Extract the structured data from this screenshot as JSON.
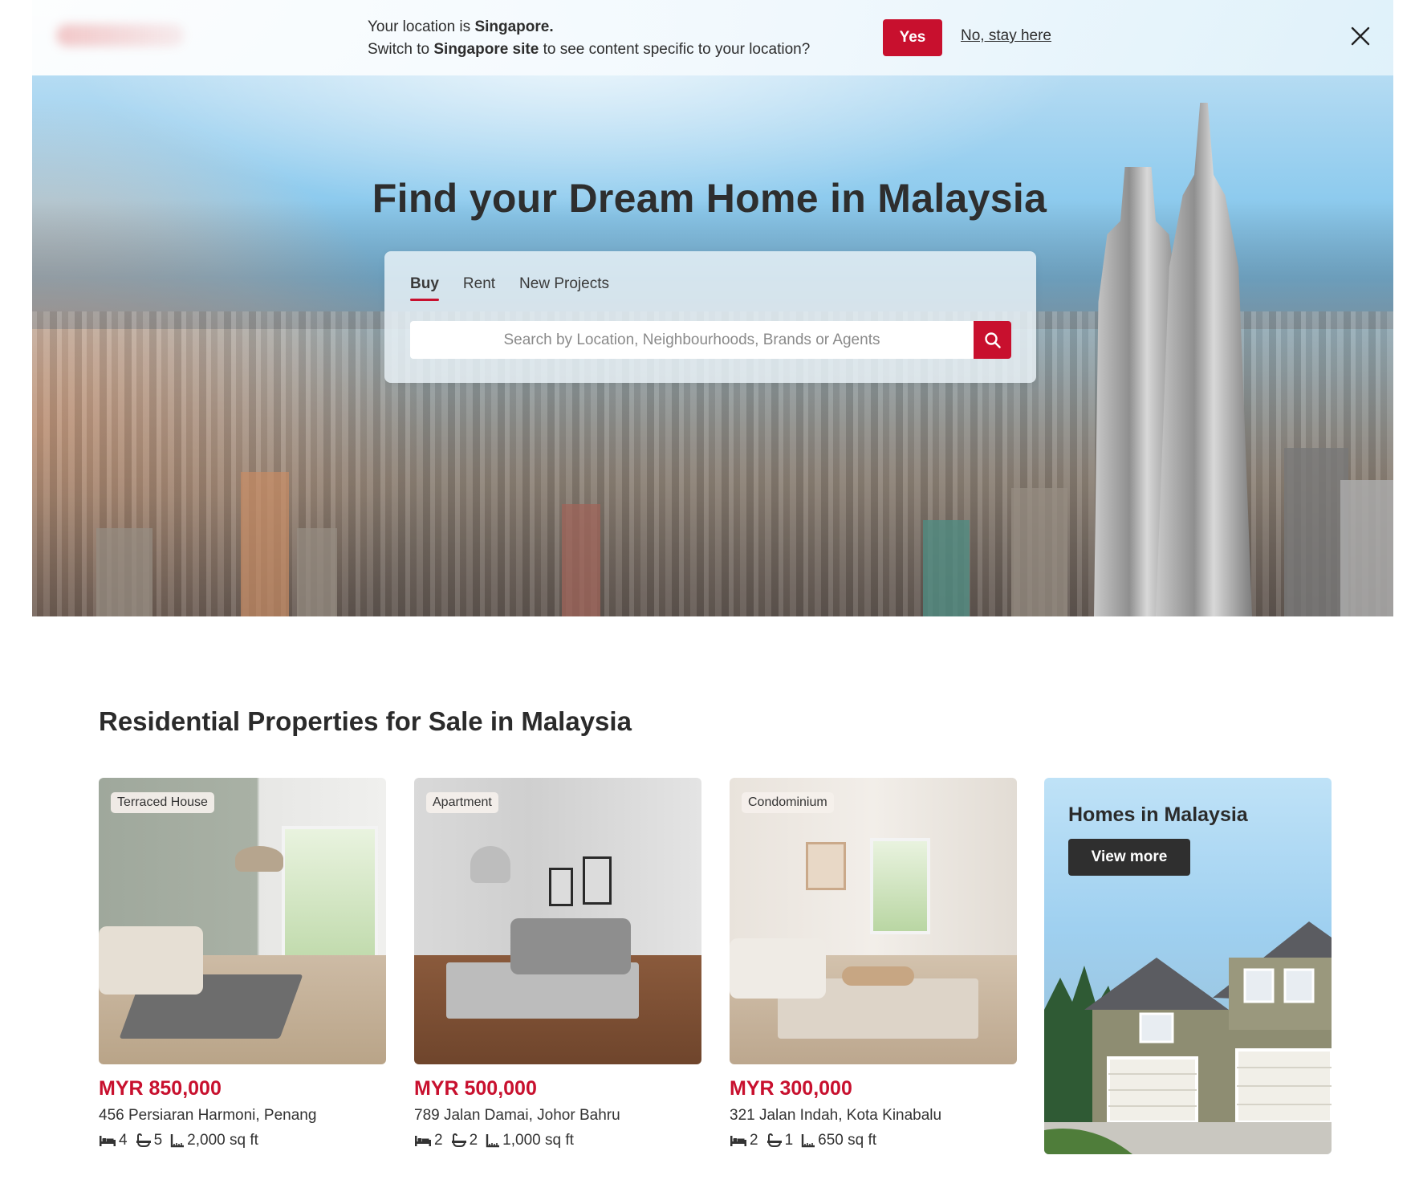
{
  "banner": {
    "line1_prefix": "Your location is ",
    "line1_bold": "Singapore.",
    "line2_prefix": "Switch to ",
    "line2_bold": "Singapore site",
    "line2_suffix": " to see content specific to your location?",
    "yes_label": "Yes",
    "stay_label": "No, stay here",
    "close_icon": "close-icon"
  },
  "hero": {
    "title": "Find your Dream Home in Malaysia",
    "tabs": [
      {
        "label": "Buy",
        "active": true
      },
      {
        "label": "Rent",
        "active": false
      },
      {
        "label": "New Projects",
        "active": false
      }
    ],
    "search_placeholder": "Search by Location, Neighbourhoods, Brands or Agents",
    "search_icon": "search-icon"
  },
  "listings": {
    "title": "Residential Properties for Sale in Malaysia",
    "cards": [
      {
        "type": "Terraced House",
        "price": "MYR 850,000",
        "address": "456 Persiaran Harmoni, Penang",
        "beds": "4",
        "baths": "5",
        "area": "2,000 sq ft"
      },
      {
        "type": "Apartment",
        "price": "MYR 500,000",
        "address": "789 Jalan Damai, Johor Bahru",
        "beds": "2",
        "baths": "2",
        "area": "1,000 sq ft"
      },
      {
        "type": "Condominium",
        "price": "MYR 300,000",
        "address": "321 Jalan Indah, Kota Kinabalu",
        "beds": "2",
        "baths": "1",
        "area": "650 sq ft"
      }
    ],
    "promo": {
      "heading": "Homes in Malaysia",
      "button_label": "View more"
    }
  },
  "colors": {
    "brand_red": "#c8102e",
    "dark_button": "#2f2f2f"
  }
}
